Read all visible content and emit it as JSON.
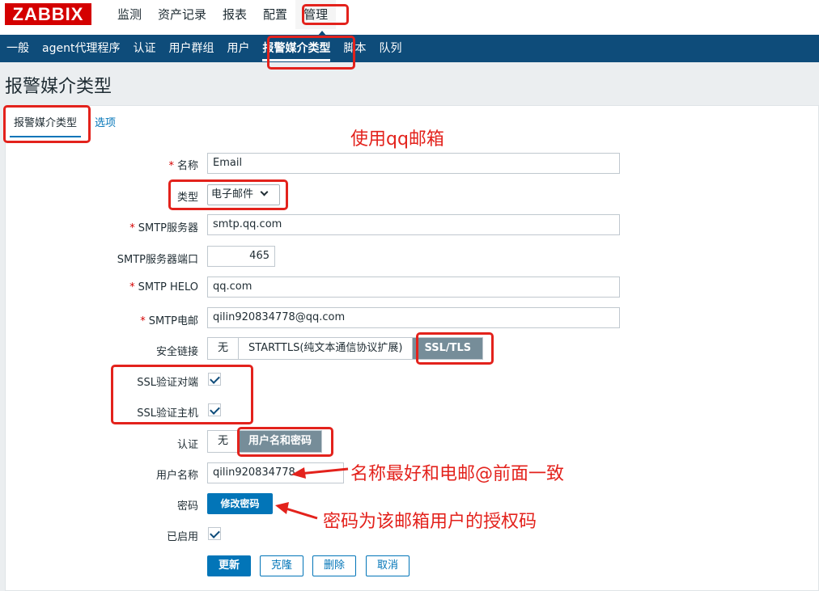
{
  "logo": "ZABBIX",
  "top_nav": [
    "监测",
    "资产记录",
    "报表",
    "配置",
    "管理"
  ],
  "sub_nav": [
    "一般",
    "agent代理程序",
    "认证",
    "用户群组",
    "用户",
    "报警媒介类型",
    "脚本",
    "队列"
  ],
  "page_title": "报警媒介类型",
  "tabs": [
    "报警媒介类型",
    "选项"
  ],
  "form": {
    "name_label": "名称",
    "name_value": "Email",
    "type_label": "类型",
    "type_value": "电子邮件",
    "smtp_server_label": "SMTP服务器",
    "smtp_server_value": "smtp.qq.com",
    "smtp_port_label": "SMTP服务器端口",
    "smtp_port_value": "465",
    "smtp_helo_label": "SMTP HELO",
    "smtp_helo_value": "qq.com",
    "smtp_email_label": "SMTP电邮",
    "smtp_email_value": "qilin920834778@qq.com",
    "security_label": "安全链接",
    "security_options": [
      "无",
      "STARTTLS(纯文本通信协议扩展)",
      "SSL/TLS"
    ],
    "security_selected": "SSL/TLS",
    "ssl_verify_peer_label": "SSL验证对端",
    "ssl_verify_host_label": "SSL验证主机",
    "auth_label": "认证",
    "auth_options": [
      "无",
      "用户名和密码"
    ],
    "auth_selected": "用户名和密码",
    "username_label": "用户名称",
    "username_value": "qilin920834778",
    "password_label": "密码",
    "change_password_button": "修改密码",
    "enabled_label": "已启用",
    "required_marker": "*"
  },
  "buttons": {
    "update": "更新",
    "clone": "克隆",
    "delete": "删除",
    "cancel": "取消"
  },
  "annotations": {
    "use_qq": "使用qq邮箱",
    "username_tip": "名称最好和电邮@前面一致",
    "password_tip": "密码为该邮箱用户的授权码"
  },
  "colors": {
    "logo_bg": "#d40000",
    "subnav_bg": "#0e4c7a",
    "primary": "#0275b8",
    "selected_segment": "#768d99",
    "annotation": "#e3221c"
  }
}
